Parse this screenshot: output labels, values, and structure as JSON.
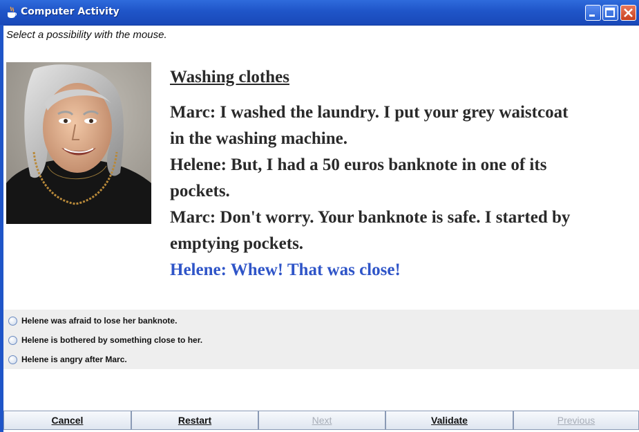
{
  "window": {
    "title": "Computer Activity"
  },
  "instruction": "Select a possibility with the mouse.",
  "story": {
    "title": "Washing clothes",
    "lines": [
      "Marc: I washed the laundry. I put your grey waistcoat",
      "in the washing machine.",
      "Helene: But, I had a 50 euros banknote in one of its",
      "pockets.",
      "Marc: Don't worry. Your banknote is safe. I started by",
      "emptying pockets.",
      "Helene: Whew! That was close!"
    ]
  },
  "options": [
    "Helene was afraid to lose her banknote.",
    "Helene is bothered by something close to her.",
    "Helene is angry after Marc."
  ],
  "buttons": {
    "cancel": "Cancel",
    "restart": "Restart",
    "next": "Next",
    "validate": "Validate",
    "previous": "Previous"
  },
  "colors": {
    "title_bar": "#1f55c8",
    "highlight_line": "#2f55c8",
    "options_background": "#eeeeee"
  },
  "icons": {
    "app": "java-coffee-cup-icon",
    "minimize": "minimize-icon",
    "maximize": "maximize-icon",
    "close": "close-icon",
    "radio": "radio-button-icon"
  }
}
